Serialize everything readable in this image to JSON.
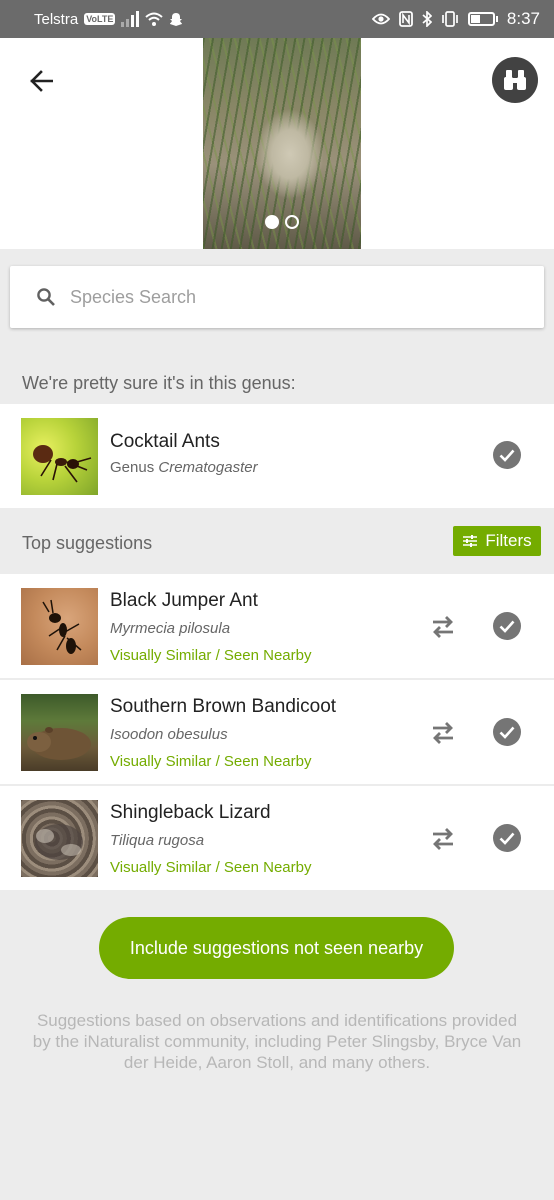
{
  "status_bar": {
    "carrier": "Telstra",
    "volte": "VoLTE",
    "time": "8:37"
  },
  "header": {
    "back_icon": "arrow-left-icon",
    "binoculars_icon": "binoculars-icon",
    "photo_count": 2,
    "photo_active_index": 0
  },
  "search": {
    "placeholder": "Species Search"
  },
  "genus_section": {
    "label": "We're pretty sure it's in this genus:",
    "item": {
      "common_name": "Cocktail Ants",
      "rank": "Genus",
      "scientific_name": "Crematogaster"
    }
  },
  "suggestions_section": {
    "label": "Top suggestions",
    "filters_label": "Filters",
    "items": [
      {
        "common_name": "Black Jumper Ant",
        "scientific_name": "Myrmecia pilosula",
        "tags": "Visually Similar / Seen Nearby"
      },
      {
        "common_name": "Southern Brown Bandicoot",
        "scientific_name": "Isoodon obesulus",
        "tags": "Visually Similar / Seen Nearby"
      },
      {
        "common_name": "Shingleback Lizard",
        "scientific_name": "Tiliqua rugosa",
        "tags": "Visually Similar / Seen Nearby"
      }
    ]
  },
  "include_button_label": "Include suggestions not seen nearby",
  "footnote": "Suggestions based on observations and identifications provided by the iNaturalist community, including Peter Slingsby, Bryce Van der Heide, Aaron Stoll, and many others.",
  "colors": {
    "accent_green": "#74ac00",
    "status_bar": "#6b6b6b",
    "background": "#ececec"
  }
}
